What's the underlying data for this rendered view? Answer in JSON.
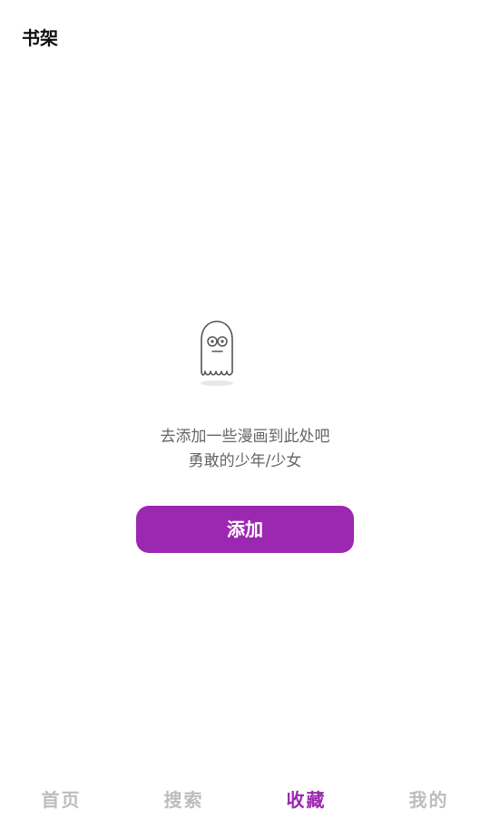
{
  "header": {
    "title": "书架"
  },
  "empty_state": {
    "icon": "ghost-icon",
    "line1": "去添加一些漫画到此处吧",
    "line2": "勇敢的少年/少女",
    "add_label": "添加"
  },
  "colors": {
    "accent": "#9c27b0",
    "nav_inactive": "#bdbdbd",
    "body_text": "#666666"
  },
  "bottom_nav": {
    "items": [
      {
        "label": "首页",
        "active": false
      },
      {
        "label": "搜索",
        "active": false
      },
      {
        "label": "收藏",
        "active": true
      },
      {
        "label": "我的",
        "active": false
      }
    ]
  }
}
